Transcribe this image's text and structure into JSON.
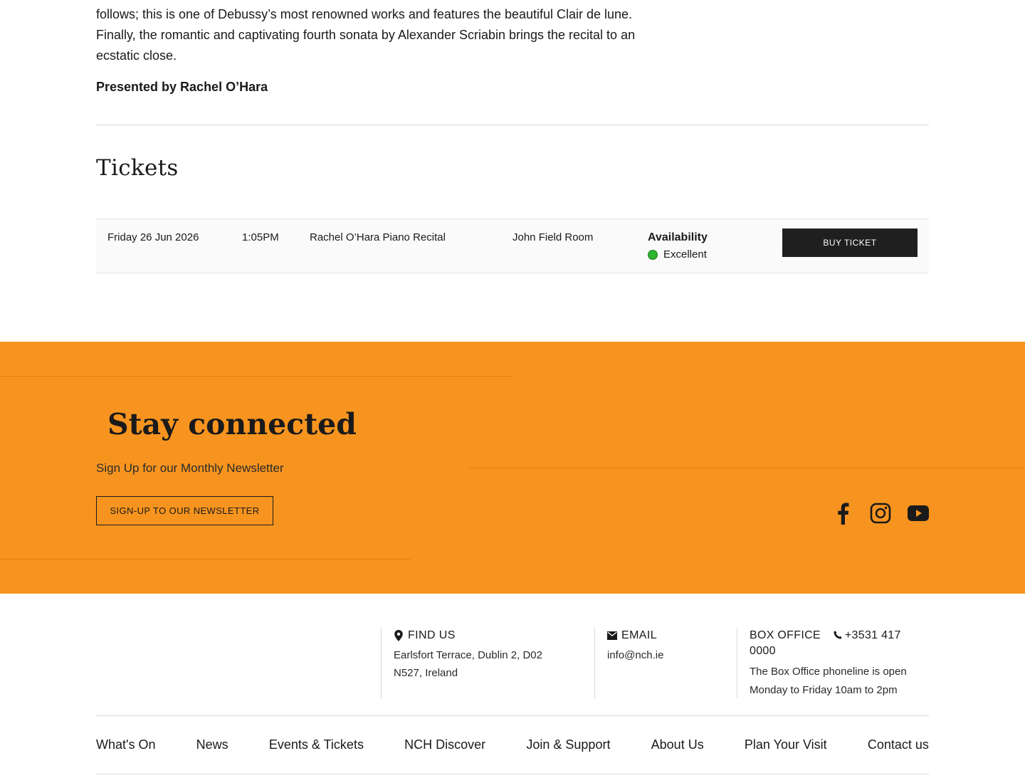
{
  "event": {
    "description_lines": [
      "follows; this is one of Debussy’s most renowned works and features the beautiful Clair de lune.",
      "Finally, the romantic and captivating fourth sonata by Alexander Scriabin brings the recital to an",
      "ecstatic close."
    ],
    "presented_by": "Presented by Rachel O’Hara"
  },
  "tickets": {
    "title": "Tickets",
    "rows": [
      {
        "date": "Friday 26 Jun 2026",
        "time": "1:05PM",
        "name": "Rachel O’Hara Piano Recital",
        "room": "John Field Room",
        "availability_label": "Availability",
        "availability_status": "Excellent",
        "button_label": "BUY TICKET"
      }
    ],
    "availability_color": "#2fb52f"
  },
  "newsletter": {
    "title": "Stay connected",
    "subtitle": "Sign Up for our Monthly Newsletter",
    "button_label": "SIGN-UP TO OUR NEWSLETTER",
    "background_color": "#f7941f",
    "social_icons": [
      "facebook-icon",
      "instagram-icon",
      "youtube-icon"
    ]
  },
  "footer": {
    "find_us": {
      "heading": "FIND US",
      "address_lines": [
        "Earlsfort Terrace, Dublin 2, D02",
        "N527, Ireland"
      ]
    },
    "email": {
      "heading": "EMAIL",
      "address": "info@nch.ie"
    },
    "box_office": {
      "heading": "BOX OFFICE",
      "phone_line1": "+3531 417",
      "phone_line2": "0000",
      "hours_lines": [
        "The Box Office phoneline is open",
        "Monday to Friday 10am to 2pm"
      ]
    },
    "nav": [
      "What's On",
      "News",
      "Events & Tickets",
      "NCH Discover",
      "Join & Support",
      "About Us",
      "Plan Your Visit",
      "Contact us"
    ]
  }
}
